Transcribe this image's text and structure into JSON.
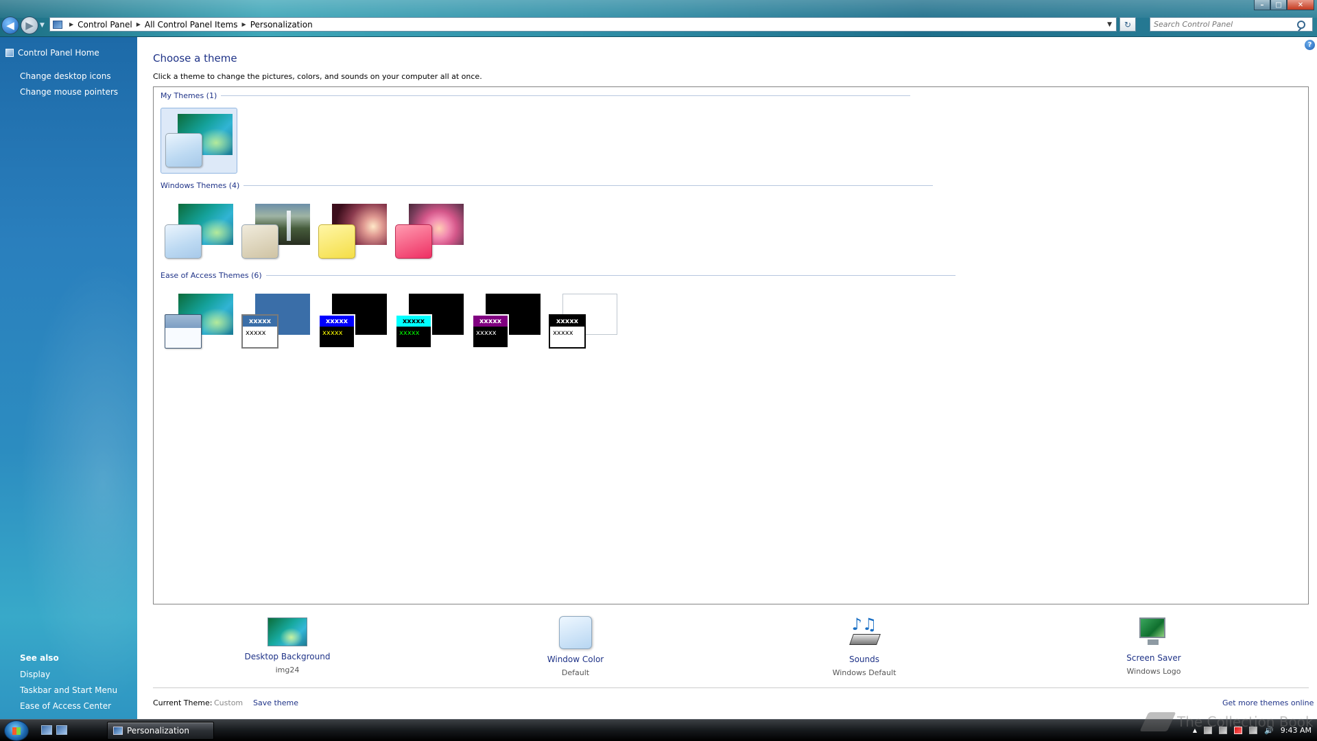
{
  "window": {
    "controls": [
      "minimize",
      "maximize",
      "close"
    ]
  },
  "address": {
    "crumbs": [
      "Control Panel",
      "All Control Panel Items",
      "Personalization"
    ]
  },
  "search": {
    "placeholder": "Search Control Panel"
  },
  "leftpane": {
    "home": "Control Panel Home",
    "links": [
      "Change desktop icons",
      "Change mouse pointers"
    ],
    "see_also_title": "See also",
    "see_also": [
      "Display",
      "Taskbar and Start Menu",
      "Ease of Access Center"
    ]
  },
  "main": {
    "title": "Choose a theme",
    "subtitle": "Click a theme to change the pictures, colors, and sounds on your computer all at once.",
    "groups": {
      "my": "My Themes (1)",
      "windows": "Windows Themes (4)",
      "ease": "Ease of Access Themes (6)"
    },
    "hc_text": "xxxxx"
  },
  "controls": {
    "background": {
      "label": "Desktop Background",
      "value": "img24"
    },
    "color": {
      "label": "Window Color",
      "value": "Default"
    },
    "sounds": {
      "label": "Sounds",
      "value": "Windows Default"
    },
    "saver": {
      "label": "Screen Saver",
      "value": "Windows Logo"
    }
  },
  "footer": {
    "current_label": "Current Theme:",
    "current_value": "Custom",
    "save": "Save theme",
    "more": "Get more themes online"
  },
  "taskbar": {
    "task": "Personalization",
    "clock": "9:43 AM"
  },
  "watermark": "The Collection Book",
  "colors": {
    "link": "#1e3287",
    "hc1_bar": "#3a6ea8",
    "hc2_bar": "#0000ff",
    "hc3_bar": "#00ffff",
    "hc4_bar": "#800080"
  }
}
